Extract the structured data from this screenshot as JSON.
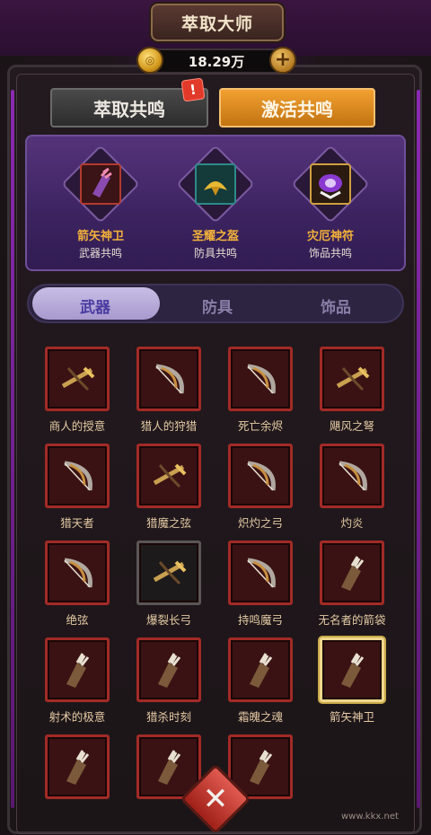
{
  "title": "萃取大师",
  "currency": {
    "icon": "coin-icon",
    "value": "18.29万",
    "add_icon": "plus-icon"
  },
  "tabs": [
    {
      "label": "萃取共鸣",
      "active": false,
      "alert": "!"
    },
    {
      "label": "激活共鸣",
      "active": true
    }
  ],
  "resonance": [
    {
      "name": "箭矢神卫",
      "type": "武器共鸣",
      "name_color": "#f3b23a",
      "icon": "quiver-icon"
    },
    {
      "name": "圣耀之盔",
      "type": "防具共鸣",
      "name_color": "#f3b23a",
      "icon": "helmet-icon"
    },
    {
      "name": "灾厄神符",
      "type": "饰品共鸣",
      "name_color": "#f3b23a",
      "icon": "amulet-icon"
    }
  ],
  "category_tabs": [
    {
      "label": "武器",
      "active": true
    },
    {
      "label": "防具",
      "active": false
    },
    {
      "label": "饰品",
      "active": false
    }
  ],
  "items": [
    {
      "name": "商人的授意",
      "icon": "crossbow-icon"
    },
    {
      "name": "猎人的狩猎",
      "icon": "bow-icon"
    },
    {
      "name": "死亡余烬",
      "icon": "bow-icon"
    },
    {
      "name": "飓风之弩",
      "icon": "crossbow-icon"
    },
    {
      "name": "猎天者",
      "icon": "bow-icon"
    },
    {
      "name": "猎魔之弦",
      "icon": "crossbow-icon"
    },
    {
      "name": "炽灼之弓",
      "icon": "bow-icon"
    },
    {
      "name": "灼炎",
      "icon": "bow-icon"
    },
    {
      "name": "绝弦",
      "icon": "bow-icon"
    },
    {
      "name": "爆裂长弓",
      "icon": "crossbow-icon",
      "locked": true
    },
    {
      "name": "持鸣魔弓",
      "icon": "bow-icon"
    },
    {
      "name": "无名者的箭袋",
      "icon": "quiver-icon"
    },
    {
      "name": "射术的极意",
      "icon": "quiver-icon"
    },
    {
      "name": "猎杀时刻",
      "icon": "quiver-icon"
    },
    {
      "name": "霜魄之魂",
      "icon": "quiver-icon"
    },
    {
      "name": "箭矢神卫",
      "icon": "quiver-icon",
      "selected": true
    },
    {
      "name": "",
      "icon": "quiver-icon"
    },
    {
      "name": "",
      "icon": "quiver-icon"
    },
    {
      "name": "",
      "icon": "quiver-icon"
    }
  ],
  "close_icon": "close-icon",
  "watermark": "www.kkx.net"
}
